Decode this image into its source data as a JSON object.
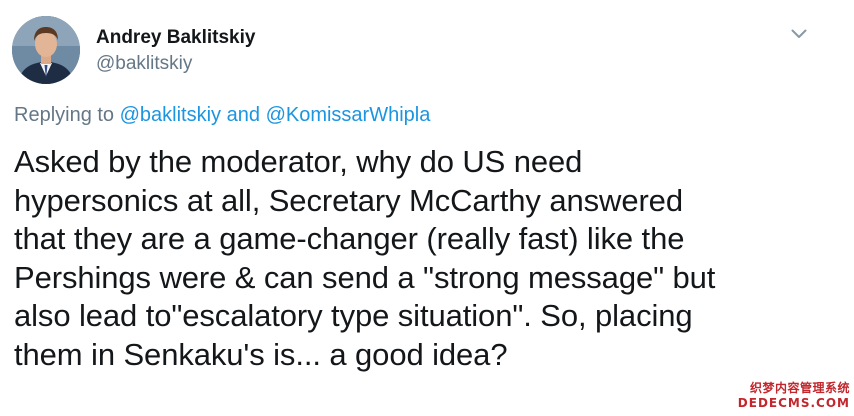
{
  "author": {
    "display_name": "Andrey Baklitskiy",
    "handle": "@baklitskiy"
  },
  "menu_icon": "chevron-down-icon",
  "reply": {
    "prefix": "Replying to",
    "mention_1": "@baklitskiy",
    "joiner": "and",
    "mention_2": "@KomissarWhipla"
  },
  "tweet_lines": [
    "Asked by the moderator, why do US need",
    "hypersonics at all, Secretary McCarthy answered",
    "that they are a game-changer (really fast) like the",
    "Pershings were & can send a \"strong message\" but",
    "also lead to\"escalatory type situation\". So, placing",
    "them in Senkaku's is... a good idea?"
  ],
  "watermark": {
    "chinese": "织梦内容管理系统",
    "url": "DEDECMS.COM"
  },
  "colors": {
    "text": "#14171a",
    "secondary": "#657786",
    "link": "#1b95e0",
    "watermark": "#c1272d"
  }
}
